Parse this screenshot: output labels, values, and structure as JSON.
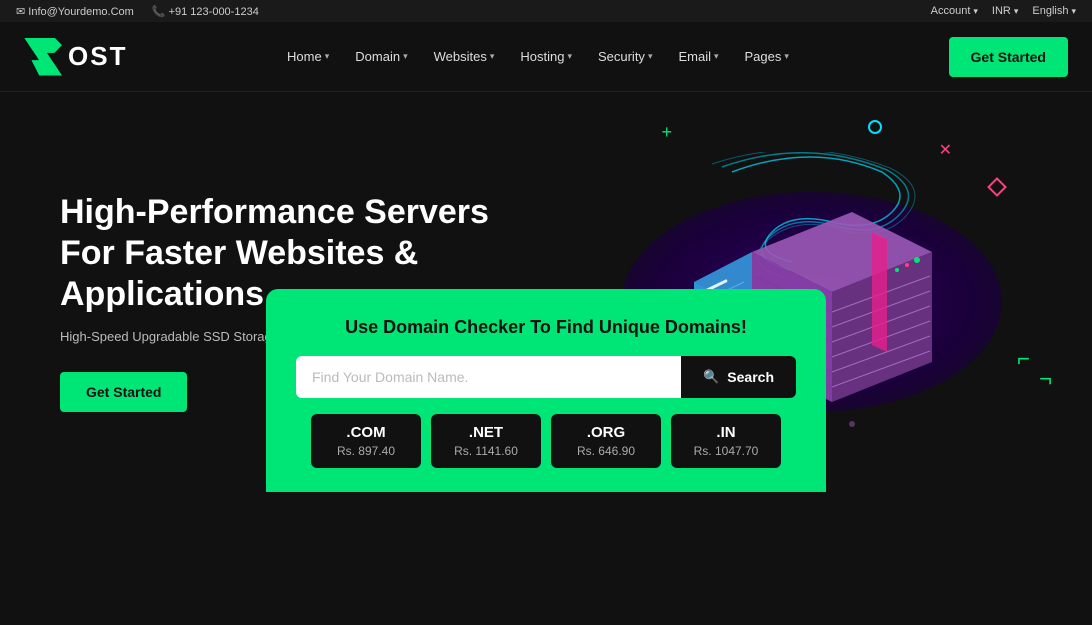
{
  "topbar": {
    "email": "Info@Yourdemo.Com",
    "phone": "+91 123-000-1234",
    "account": "Account",
    "currency": "INR",
    "language": "English"
  },
  "navbar": {
    "logo_text": "OST",
    "nav_items": [
      {
        "label": "Home"
      },
      {
        "label": "Domain"
      },
      {
        "label": "Websites"
      },
      {
        "label": "Hosting"
      },
      {
        "label": "Security"
      },
      {
        "label": "Email"
      },
      {
        "label": "Pages"
      }
    ],
    "cta_label": "Get Started"
  },
  "hero": {
    "headline": "High-Performance Servers For Faster Websites & Applications",
    "subtext": "High-Speed Upgradable SSD Storage, Instant Provisioning, Full Root Access.",
    "cta_label": "Get Started"
  },
  "domain_checker": {
    "title": "Use Domain Checker To Find Unique Domains!",
    "input_placeholder": "Find Your Domain Name.",
    "search_label": "Search",
    "extensions": [
      {
        "ext": ".COM",
        "price": "Rs. 897.40"
      },
      {
        "ext": ".NET",
        "price": "Rs. 1141.60"
      },
      {
        "ext": ".ORG",
        "price": "Rs. 646.90"
      },
      {
        "ext": ".IN",
        "price": "Rs. 1047.70"
      }
    ]
  }
}
